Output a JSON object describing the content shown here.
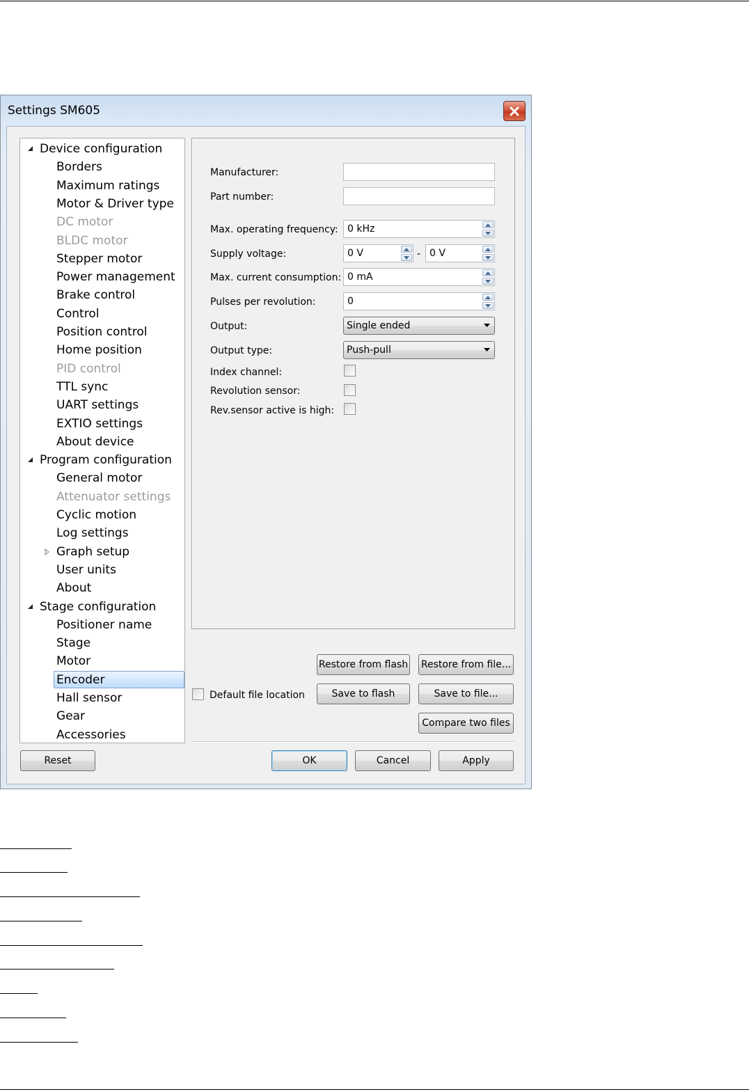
{
  "window": {
    "title": "Settings SM605"
  },
  "tree": [
    {
      "label": "Device configuration",
      "level": 0,
      "expander": "expanded",
      "state": "normal"
    },
    {
      "label": "Borders",
      "level": 1,
      "state": "normal"
    },
    {
      "label": "Maximum ratings",
      "level": 1,
      "state": "normal"
    },
    {
      "label": "Motor & Driver type",
      "level": 1,
      "state": "normal"
    },
    {
      "label": "DC motor",
      "level": 1,
      "state": "disabled"
    },
    {
      "label": "BLDC motor",
      "level": 1,
      "state": "disabled"
    },
    {
      "label": "Stepper motor",
      "level": 1,
      "state": "normal"
    },
    {
      "label": "Power management",
      "level": 1,
      "state": "normal"
    },
    {
      "label": "Brake control",
      "level": 1,
      "state": "normal"
    },
    {
      "label": "Control",
      "level": 1,
      "state": "normal"
    },
    {
      "label": "Position control",
      "level": 1,
      "state": "normal"
    },
    {
      "label": "Home position",
      "level": 1,
      "state": "normal"
    },
    {
      "label": "PID control",
      "level": 1,
      "state": "disabled"
    },
    {
      "label": "TTL sync",
      "level": 1,
      "state": "normal"
    },
    {
      "label": "UART settings",
      "level": 1,
      "state": "normal"
    },
    {
      "label": "EXTIO settings",
      "level": 1,
      "state": "normal"
    },
    {
      "label": "About device",
      "level": 1,
      "state": "normal"
    },
    {
      "label": "Program configuration",
      "level": 0,
      "expander": "expanded",
      "state": "normal"
    },
    {
      "label": "General motor",
      "level": 1,
      "state": "normal"
    },
    {
      "label": "Attenuator settings",
      "level": 1,
      "state": "disabled"
    },
    {
      "label": "Cyclic motion",
      "level": 1,
      "state": "normal"
    },
    {
      "label": "Log settings",
      "level": 1,
      "state": "normal"
    },
    {
      "label": "Graph setup",
      "level": 1,
      "expander": "collapsed",
      "state": "normal"
    },
    {
      "label": "User units",
      "level": 1,
      "state": "normal"
    },
    {
      "label": "About",
      "level": 1,
      "state": "normal"
    },
    {
      "label": "Stage configuration",
      "level": 0,
      "expander": "expanded",
      "state": "normal"
    },
    {
      "label": "Positioner name",
      "level": 1,
      "state": "normal"
    },
    {
      "label": "Stage",
      "level": 1,
      "state": "normal"
    },
    {
      "label": "Motor",
      "level": 1,
      "state": "normal"
    },
    {
      "label": "Encoder",
      "level": 1,
      "state": "selected"
    },
    {
      "label": "Hall sensor",
      "level": 1,
      "state": "normal"
    },
    {
      "label": "Gear",
      "level": 1,
      "state": "normal"
    },
    {
      "label": "Accessories",
      "level": 1,
      "state": "normal"
    }
  ],
  "form": {
    "manufacturer": {
      "label": "Manufacturer:",
      "value": ""
    },
    "part_number": {
      "label": "Part number:",
      "value": ""
    },
    "max_frequency": {
      "label": "Max. operating frequency:",
      "value": "0 kHz"
    },
    "supply_voltage": {
      "label": "Supply voltage:",
      "min": "0 V",
      "separator": "-",
      "max": "0 V"
    },
    "max_current": {
      "label": "Max. current consumption:",
      "value": "0 mA"
    },
    "pulses_per_rev": {
      "label": "Pulses per revolution:",
      "value": "0"
    },
    "output": {
      "label": "Output:",
      "value": "Single ended"
    },
    "output_type": {
      "label": "Output type:",
      "value": "Push-pull"
    },
    "index_channel": {
      "label": "Index channel:",
      "checked": false
    },
    "revolution_sensor": {
      "label": "Revolution sensor:",
      "checked": false
    },
    "rev_sensor_active_high": {
      "label": "Rev.sensor active is high:",
      "checked": false
    }
  },
  "file_actions": {
    "restore_flash": "Restore from flash",
    "restore_file": "Restore from file...",
    "default_location_label": "Default file location",
    "default_location_checked": false,
    "save_flash": "Save to flash",
    "save_file": "Save to file...",
    "compare": "Compare two files"
  },
  "dialog_buttons": {
    "reset": "Reset",
    "ok": "OK",
    "cancel": "Cancel",
    "apply": "Apply"
  },
  "colors": {
    "disabled_text": "#9b9b9b",
    "selection_border": "#7da2ce",
    "close_button": "#c33b22"
  }
}
